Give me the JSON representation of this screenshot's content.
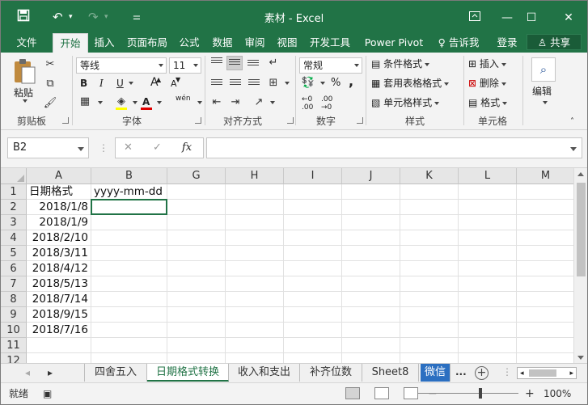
{
  "title_bar": {
    "title": "素材 - Excel",
    "save_icon": "save-icon",
    "undo_icon": "undo-icon",
    "redo_icon": "redo-icon",
    "customize_icon": "customize-qat-icon",
    "ribbon_options_icon": "ribbon-display-options-icon",
    "minimize_icon": "minimize-icon",
    "restore_icon": "restore-icon",
    "close_icon": "close-icon",
    "accent_color": "#217346"
  },
  "menu": {
    "tabs": [
      "文件",
      "开始",
      "插入",
      "页面布局",
      "公式",
      "数据",
      "审阅",
      "视图",
      "开发工具",
      "Power Pivot"
    ],
    "active_tab": "开始",
    "tell_me": "告诉我",
    "login": "登录",
    "share": "共享"
  },
  "ribbon": {
    "clipboard": {
      "label": "剪贴板",
      "paste": "粘贴"
    },
    "font": {
      "label": "字体",
      "font_name": "等线",
      "font_size": "11",
      "bold": "B",
      "italic": "I",
      "underline": "U",
      "grow": "A",
      "shrink": "A",
      "phonetic": "wén",
      "font_color_letter": "A"
    },
    "alignment": {
      "label": "对齐方式"
    },
    "number": {
      "label": "数字",
      "format": "常规",
      "percent": "%",
      "comma": ","
    },
    "styles": {
      "label": "样式",
      "conditional": "条件格式",
      "table": "套用表格格式",
      "cell_styles": "单元格样式"
    },
    "cells": {
      "label": "单元格",
      "insert": "插入",
      "delete": "删除",
      "format": "格式"
    },
    "editing": {
      "label": "编辑"
    }
  },
  "formula_bar": {
    "name_box": "B2",
    "cancel": "✕",
    "enter": "✓",
    "fx": "fx",
    "content": ""
  },
  "grid": {
    "columns": [
      "A",
      "B",
      "G",
      "H",
      "I",
      "J",
      "K",
      "L",
      "M"
    ],
    "rows": [
      "1",
      "2",
      "3",
      "4",
      "5",
      "6",
      "7",
      "8",
      "9",
      "10",
      "11",
      "12"
    ],
    "cells": {
      "A1": "日期格式",
      "B1": "yyyy-mm-dd",
      "A2": "2018/1/8",
      "A3": "2018/1/9",
      "A4": "2018/2/10",
      "A5": "2018/3/11",
      "A6": "2018/4/12",
      "A7": "2018/5/13",
      "A8": "2018/7/14",
      "A9": "2018/9/15",
      "A10": "2018/7/16"
    },
    "selected_cell": "B2"
  },
  "sheet_tabs": {
    "tabs": [
      "四舍五入",
      "日期格式转换",
      "收入和支出",
      "补齐位数",
      "Sheet8",
      "微信"
    ],
    "active": "日期格式转换",
    "more": "...",
    "add": "+"
  },
  "status_bar": {
    "ready": "就绪",
    "zoom": "100%",
    "zoom_out": "−",
    "zoom_in": "+"
  }
}
